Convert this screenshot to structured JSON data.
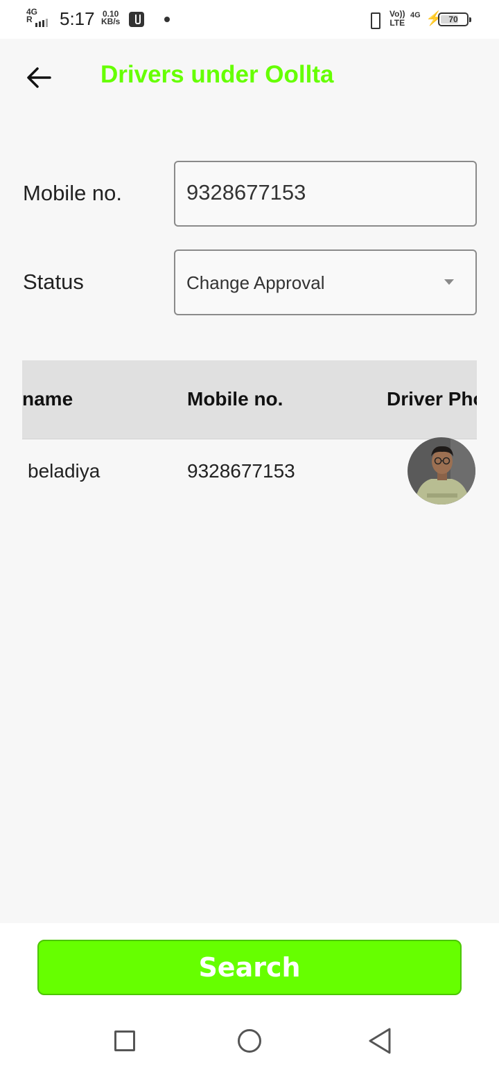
{
  "status_bar": {
    "network": "4G",
    "roaming": "R",
    "time": "5:17",
    "speed_value": "0.10",
    "speed_unit": "KB/s",
    "volte_top": "Vo))",
    "volte_bottom": "LTE",
    "network_right": "4G",
    "battery": "70",
    "battery_level": 0.7
  },
  "header": {
    "title": "Drivers under Oollta",
    "title_color": "#66ff00"
  },
  "form": {
    "mobile_label": "Mobile no.",
    "mobile_value": "9328677153",
    "status_label": "Status",
    "status_selected": "Change Approval"
  },
  "table": {
    "columns": [
      "name",
      "Mobile no.",
      "Driver Pho"
    ],
    "rows": [
      {
        "name": "beladiya",
        "mobile": "9328677153"
      }
    ]
  },
  "actions": {
    "search_label": "Search",
    "accent_color": "#66ff00"
  },
  "icons": {
    "back": "arrow-left-icon",
    "dropdown": "caret-down-icon",
    "nav_recents": "square-icon",
    "nav_home": "circle-icon",
    "nav_back": "triangle-back-icon"
  }
}
